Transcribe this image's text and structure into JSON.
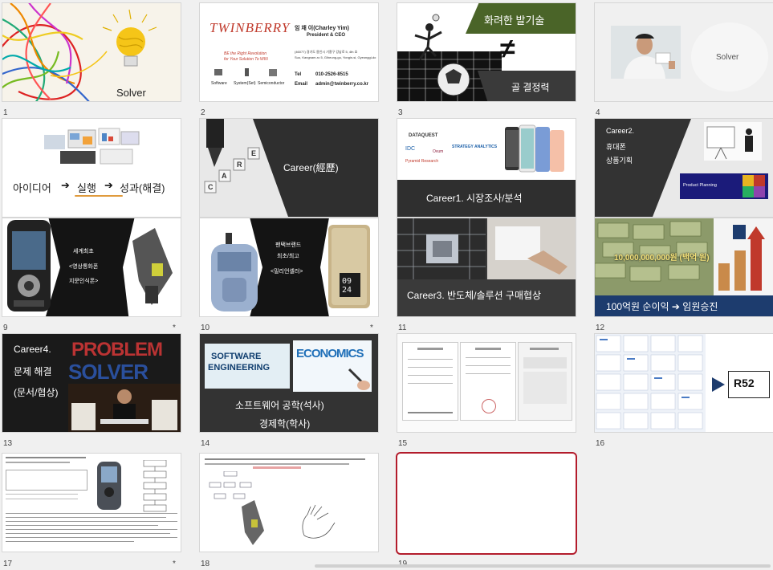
{
  "slides": [
    {
      "num": "1",
      "title": "Solver"
    },
    {
      "num": "2",
      "logo": "TWINBERRY",
      "tagline1": "BE the Right Revolution",
      "tagline2": "for Your Solution To WIN",
      "name": "임 채 이(Charley Yim)",
      "role": "President  &  CEO",
      "addr1": "(46077) 경기도 용인시 기흥구 강남로 5, 4th 호",
      "addr2": "Suo, Kangnam-ro 5, Giheung-gu, Yongin-si, Gyeonggi-do",
      "tel_label": "Tel",
      "tel": "010-2526-8515",
      "email_label": "Email",
      "email": "admin@twinberry.co.kr",
      "icons": [
        "Software",
        "System(Set)",
        "Semiconductor"
      ]
    },
    {
      "num": "3",
      "top": "화려한 발기술",
      "sym": "≠",
      "bottom": "골 결정력"
    },
    {
      "num": "4",
      "word": "Solver"
    },
    {
      "num": "5",
      "text_a": "아이디어",
      "arrow": "➔",
      "text_b": "실행",
      "text_c": "성과(해결)"
    },
    {
      "num": "6",
      "title": "Career(經歷)",
      "letters": [
        "C",
        "A",
        "R",
        "E"
      ]
    },
    {
      "num": "7",
      "logos": [
        "DATAQUEST",
        "IDC",
        "Ovum",
        "STRATEGY ANALYTICS",
        "Pyramid Research"
      ],
      "caption": "Career1. 시장조사/분석"
    },
    {
      "num": "8",
      "l1": "Career2.",
      "l2": "휴대폰",
      "l3": "상품기획",
      "badge": "Product Planning"
    },
    {
      "num": "9",
      "l1": "세계최초",
      "l2": "<영상통화폰",
      "l3": "지문인식폰>",
      "brand": "PANTECH",
      "star": "*"
    },
    {
      "num": "10",
      "l1": "팬택브랜드",
      "l2": "최초/최고",
      "l3": "<밀리언셀러>",
      "lcd": "09 24",
      "star": "*"
    },
    {
      "num": "11",
      "caption": "Career3. 반도체/솔루션 구매협상"
    },
    {
      "num": "12",
      "money": "10,000,000,000원 (백억 원)",
      "caption": "100억원 순이익 ➔ 임원승진"
    },
    {
      "num": "13",
      "l1": "Career4.",
      "l2": "문제 해결",
      "l3": "(문서/협상)",
      "bg1": "PROBLEM",
      "bg2": "SOLVER"
    },
    {
      "num": "14",
      "board1": "SOFTWARE",
      "board2": "ENGINEERING",
      "board3": "ECONOMICS",
      "c1": "소프트웨어 공학(석사)",
      "c2": "경제학(학사)"
    },
    {
      "num": "15"
    },
    {
      "num": "16",
      "logo": "R52"
    },
    {
      "num": "17",
      "star": "*"
    },
    {
      "num": "18"
    },
    {
      "num": "19"
    }
  ]
}
